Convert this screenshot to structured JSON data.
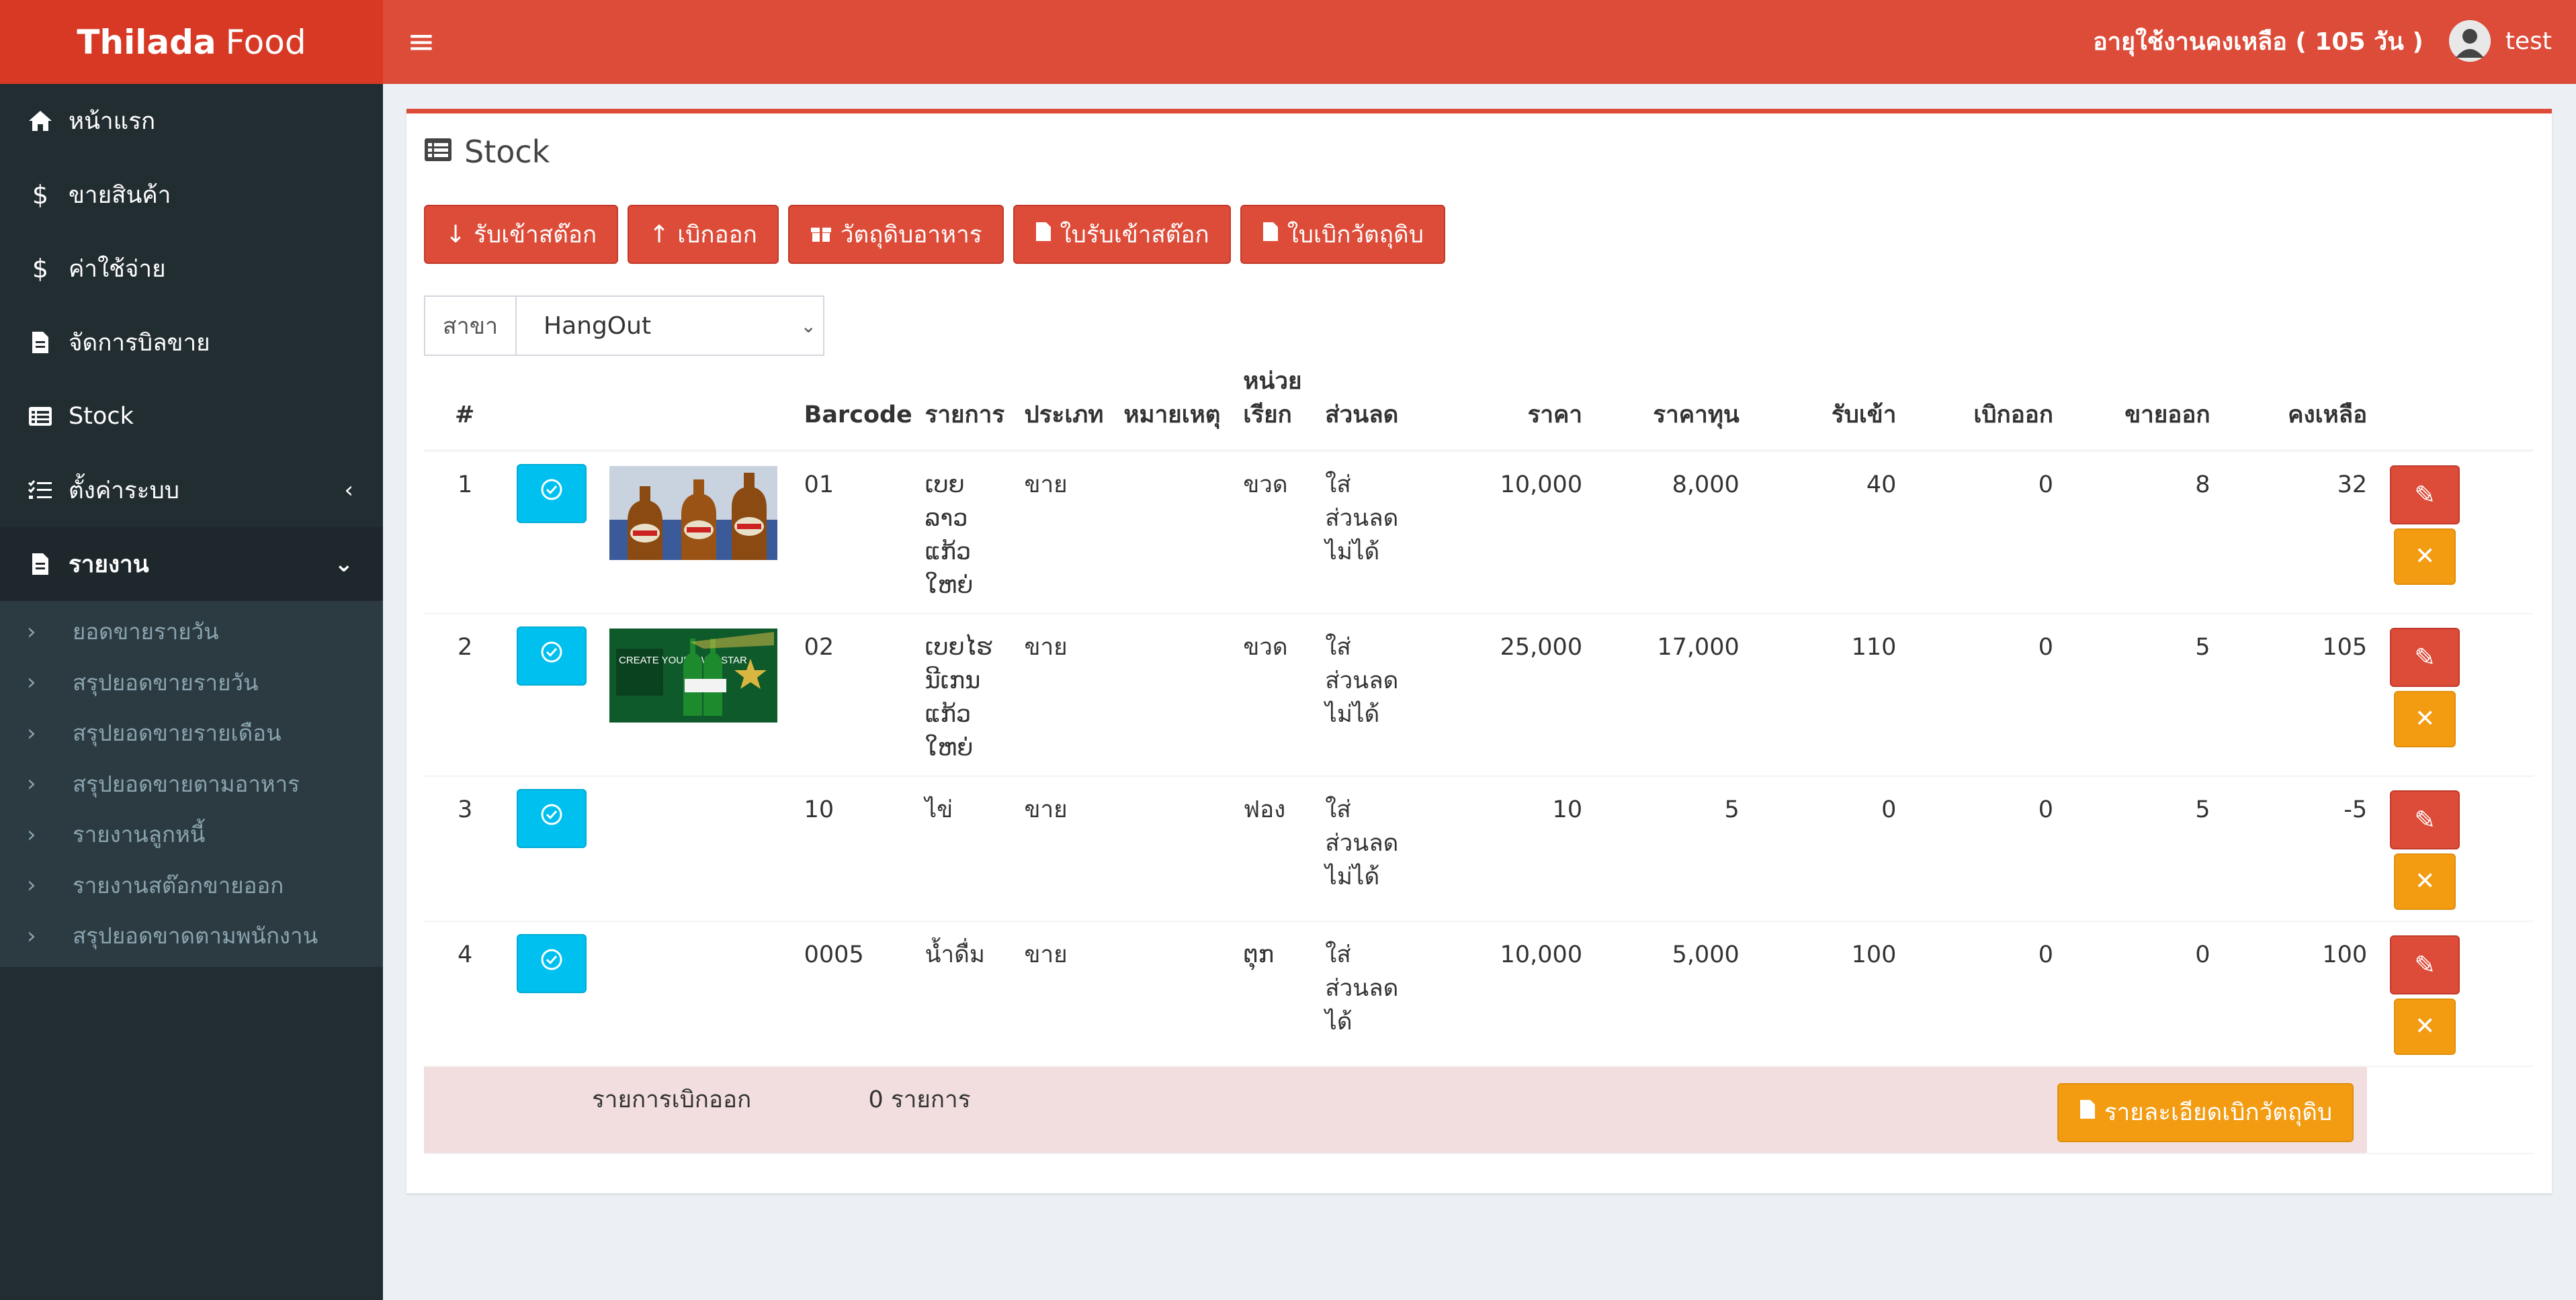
{
  "app": {
    "brand_bold": "Thilada",
    "brand_light": "Food"
  },
  "header": {
    "expiry": "อายุใช้งานคงเหลือ ( 105 วัน )",
    "user": "test"
  },
  "sidebar": {
    "items": [
      {
        "label": "หน้าแรก",
        "icon": "home-icon"
      },
      {
        "label": "ขายสินค้า",
        "icon": "dollar-icon"
      },
      {
        "label": "ค่าใช้จ่าย",
        "icon": "dollar-icon"
      },
      {
        "label": "จัดการบิลขาย",
        "icon": "file-icon"
      },
      {
        "label": "Stock",
        "icon": "list-icon"
      },
      {
        "label": "ตั้งค่าระบบ",
        "icon": "tasks-icon"
      },
      {
        "label": "รายงาน",
        "icon": "file-icon"
      }
    ],
    "report_sub": [
      "ยอดขายรายวัน",
      "สรุปยอดขายรายวัน",
      "สรุปยอดขายรายเดือน",
      "สรุปยอดขายตามอาหาร",
      "รายงานลูกหนี้",
      "รายงานสต๊อกขายออก",
      "สรุปยอดขาดตามพนักงาน"
    ]
  },
  "page": {
    "title": "Stock",
    "buttons": {
      "receive": "รับเข้าสต๊อก",
      "withdraw": "เบิกออก",
      "materials": "วัตถุดิบอาหาร",
      "receipt": "ใบรับเข้าสต๊อก",
      "requisition": "ใบเบิกวัตถุดิบ"
    },
    "branch": {
      "label": "สาขา",
      "value": "HangOut"
    }
  },
  "table": {
    "headers": {
      "num": "#",
      "barcode": "Barcode",
      "item": "รายการ",
      "type": "ประเภท",
      "note": "หมายเหตุ",
      "unit": "หน่วยเรียก",
      "discount": "ส่วนลด",
      "price": "ราคา",
      "cost": "ราคาทุน",
      "in": "รับเข้า",
      "out": "เบิกออก",
      "sold": "ขายออก",
      "remain": "คงเหลือ"
    },
    "rows": [
      {
        "num": "1",
        "barcode": "01",
        "item": "ເບຍ ລາວ ແກ້ວ ໃຫຍ່",
        "type": "ขาย",
        "note": "",
        "unit": "ขวด",
        "discount": "ใส่ ส่วนลด ไม่ได้",
        "price": "10,000",
        "cost": "8,000",
        "in": "40",
        "out": "0",
        "sold": "8",
        "remain": "32"
      },
      {
        "num": "2",
        "barcode": "02",
        "item": "ເບຍໄຮ ນີເກນ ແກ້ວ ໃຫຍ່",
        "type": "ขาย",
        "note": "",
        "unit": "ขวด",
        "discount": "ใส่ ส่วนลด ไม่ได้",
        "price": "25,000",
        "cost": "17,000",
        "in": "110",
        "out": "0",
        "sold": "5",
        "remain": "105"
      },
      {
        "num": "3",
        "barcode": "10",
        "item": "ไข่",
        "type": "ขาย",
        "note": "",
        "unit": "ฟอง",
        "discount": "ใส่ ส่วนลด ไม่ได้",
        "price": "10",
        "cost": "5",
        "in": "0",
        "out": "0",
        "sold": "5",
        "remain": "-5"
      },
      {
        "num": "4",
        "barcode": "0005",
        "item": "น้ำดื่ม",
        "type": "ขาย",
        "note": "",
        "unit": "ຕຸກ",
        "discount": "ใส่ ส่วนลด ได้",
        "price": "10,000",
        "cost": "5,000",
        "in": "100",
        "out": "0",
        "sold": "0",
        "remain": "100"
      }
    ],
    "heineken_text": "CREATE YOUR OWN STAR",
    "summary": {
      "label": "รายการเบิกออก",
      "count": "0 รายการ",
      "button": "รายละเอียดเบิกวัตถุดิบ"
    }
  }
}
